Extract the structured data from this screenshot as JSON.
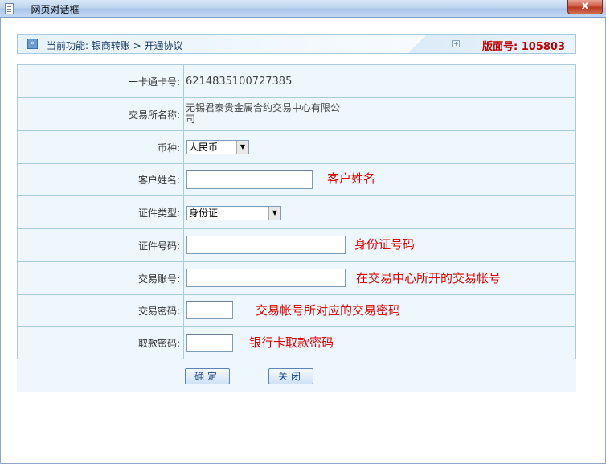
{
  "window": {
    "title": "-- 网页对话框",
    "close": "x"
  },
  "header": {
    "box_icon": "»",
    "breadcrumb": "当前功能:  银商转账  > 开通协议",
    "small_box": "+",
    "version": "版面号: 105803"
  },
  "form": {
    "card_label": "一卡通卡号:",
    "card_value": "6214835100727385",
    "exchange_label": "交易所名称:",
    "exchange_value": "无锡君泰贵金属合约交易中心有限公司",
    "currency_label": "币种:",
    "currency_value": "人民币",
    "name_label": "客户姓名:",
    "name_hint": "客户姓名",
    "idtype_label": "证件类型:",
    "idtype_value": "身份证",
    "idno_label": "证件号码:",
    "idno_hint": "身份证号码",
    "account_label": "交易账号:",
    "account_hint": "在交易中心所开的交易帐号",
    "tradepwd_label": "交易密码:",
    "tradepwd_hint": "交易帐号所对应的交易密码",
    "withdrawpwd_label": "取款密码:",
    "withdrawpwd_hint": "银行卡取款密码"
  },
  "buttons": {
    "confirm": "确定",
    "close": "关闭"
  },
  "icons": [
    "page-icon",
    "close-icon",
    "collapse-icon",
    "expand-icon",
    "dropdown-arrow-icon"
  ],
  "colors": {
    "hint": "#e00000",
    "version": "#c00000",
    "table_bg": "#eef7fd",
    "border": "#a8cbe0"
  }
}
